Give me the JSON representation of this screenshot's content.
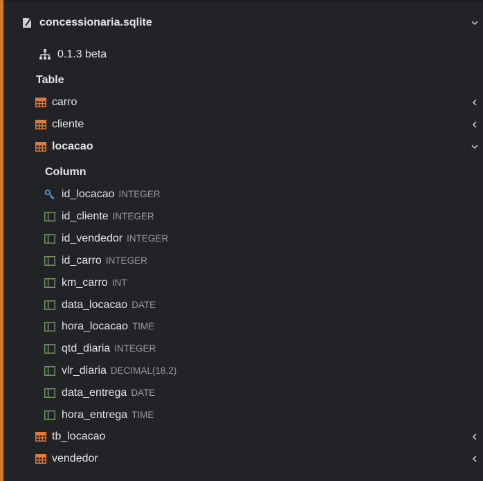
{
  "db": {
    "name": "concessionaria.sqlite",
    "version": "0.1.3 beta"
  },
  "tables_heading": "Table",
  "tables": [
    {
      "name": "carro",
      "expanded": false
    },
    {
      "name": "cliente",
      "expanded": false
    },
    {
      "name": "locacao",
      "expanded": true
    },
    {
      "name": "tb_locacao",
      "expanded": false
    },
    {
      "name": "vendedor",
      "expanded": false
    }
  ],
  "columns_heading": "Column",
  "columns": [
    {
      "name": "id_locacao",
      "type": "INTEGER",
      "icon": "primary-key-icon"
    },
    {
      "name": "id_cliente",
      "type": "INTEGER",
      "icon": "column-icon"
    },
    {
      "name": "id_vendedor",
      "type": "INTEGER",
      "icon": "column-icon"
    },
    {
      "name": "id_carro",
      "type": "INTEGER",
      "icon": "column-icon"
    },
    {
      "name": "km_carro",
      "type": "INT",
      "icon": "column-icon"
    },
    {
      "name": "data_locacao",
      "type": "DATE",
      "icon": "column-icon"
    },
    {
      "name": "hora_locacao",
      "type": "TIME",
      "icon": "column-icon"
    },
    {
      "name": "qtd_diaria",
      "type": "INTEGER",
      "icon": "column-icon"
    },
    {
      "name": "vlr_diaria",
      "type": "DECIMAL(18,2)",
      "icon": "column-icon"
    },
    {
      "name": "data_entrega",
      "type": "DATE",
      "icon": "column-icon"
    },
    {
      "name": "hora_entrega",
      "type": "TIME",
      "icon": "column-icon"
    }
  ],
  "colors": {
    "background": "#222326",
    "accent": "#d3792d",
    "table_icon": "#e07b39",
    "column_icon": "#6a9955",
    "key_icon": "#569cd6"
  }
}
